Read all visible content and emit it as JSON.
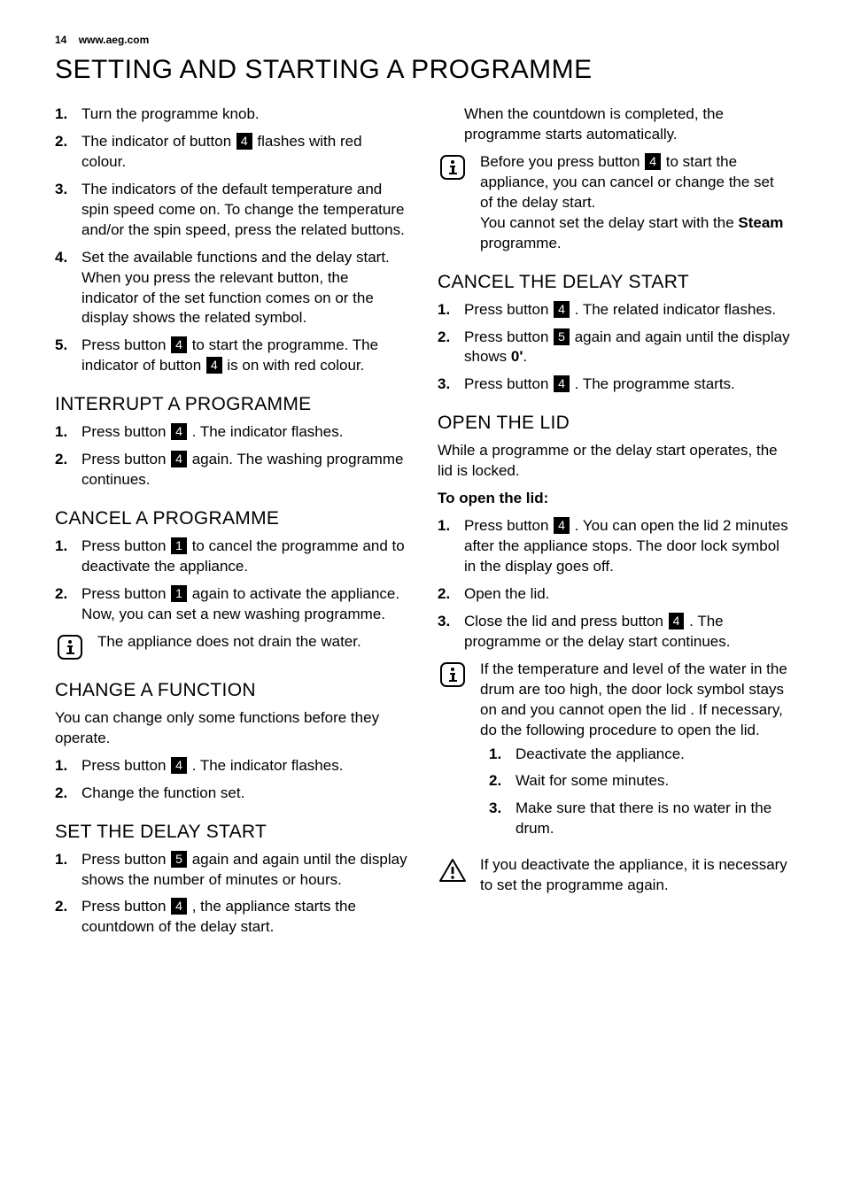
{
  "meta": {
    "page_number": "14",
    "url": "www.aeg.com"
  },
  "title": "SETTING AND STARTING A PROGRAMME",
  "buttons": {
    "b1": "1",
    "b4": "4",
    "b5": "5"
  },
  "col1": {
    "intro_list": [
      {
        "pre": "Turn the programme knob."
      },
      {
        "pre": "The indicator of button ",
        "btn": "b4",
        "post": " flashes with red colour."
      },
      {
        "pre": "The indicators of the default temperature and spin speed come on. To change the temperature and/or the spin speed, press the related buttons."
      },
      {
        "pre": "Set the available functions and the delay start. When you press the relevant button, the indicator of the set function comes on or the display shows the related symbol."
      },
      {
        "pre": "Press button ",
        "btn": "b4",
        "post": " to start the programme. The indicator of button ",
        "btn2": "b4",
        "post2": " is on with red colour."
      }
    ],
    "interrupt": {
      "h": "INTERRUPT A PROGRAMME",
      "items": [
        {
          "pre": "Press button ",
          "btn": "b4",
          "post": " . The indicator flashes."
        },
        {
          "pre": "Press button ",
          "btn": "b4",
          "post": " again. The washing programme continues."
        }
      ]
    },
    "cancel": {
      "h": "CANCEL A PROGRAMME",
      "items": [
        {
          "pre": "Press button ",
          "btn": "b1",
          "post": " to cancel the programme and to deactivate the appliance."
        },
        {
          "pre": "Press button ",
          "btn": "b1",
          "post": " again to activate the appliance. Now, you can set a new washing programme."
        }
      ],
      "note": "The appliance does not drain the water."
    },
    "change": {
      "h": "CHANGE A FUNCTION",
      "lead": "You can change only some functions before they operate.",
      "items": [
        {
          "pre": "Press button ",
          "btn": "b4",
          "post": " . The indicator flashes."
        },
        {
          "pre": "Change the function set."
        }
      ]
    },
    "delay": {
      "h": "SET THE DELAY START",
      "items": [
        {
          "pre": "Press button ",
          "btn": "b5",
          "post": " again and again until the display shows the number of minutes or hours."
        },
        {
          "pre": "Press button ",
          "btn": "b4",
          "post": " , the appliance starts the countdown of the delay start."
        }
      ]
    }
  },
  "col2": {
    "lead": "When the countdown is completed, the programme starts automatically.",
    "note1": {
      "pre": "Before you press button ",
      "btn": "b4",
      "post": " to start the appliance, you can cancel or change the set of the delay start.",
      "line2_pre": "You cannot set the delay start with the ",
      "bold": "Steam",
      "line2_post": " programme."
    },
    "cancel_delay": {
      "h": "CANCEL THE DELAY START",
      "items": [
        {
          "pre": "Press button ",
          "btn": "b4",
          "post": " . The related indicator flashes."
        },
        {
          "pre": "Press button ",
          "btn": "b5",
          "post": " again and again until the display shows ",
          "bold": "0'",
          "post2": "."
        },
        {
          "pre": "Press button ",
          "btn": "b4",
          "post": " . The programme starts."
        }
      ]
    },
    "open_lid": {
      "h": "OPEN THE LID",
      "lead": "While a programme or the delay start operates, the lid is locked.",
      "sub": "To open the lid:",
      "items": [
        {
          "pre": "Press button ",
          "btn": "b4",
          "post": " . You can open the lid 2 minutes after the appliance stops. The door lock symbol in the display goes off."
        },
        {
          "pre": "Open the lid."
        },
        {
          "pre": "Close the lid and press button ",
          "btn": "b4",
          "post": " . The programme or the delay start continues."
        }
      ],
      "note_info": {
        "lead": "If the temperature and level of the water in the drum are too high, the door lock symbol stays on and you cannot open the lid . If necessary, do the following procedure to open the lid.",
        "items": [
          "Deactivate the appliance.",
          "Wait for some minutes.",
          "Make sure that there is no water in the drum."
        ]
      },
      "note_warn": "If you deactivate the appliance, it is necessary to set the programme again."
    }
  }
}
